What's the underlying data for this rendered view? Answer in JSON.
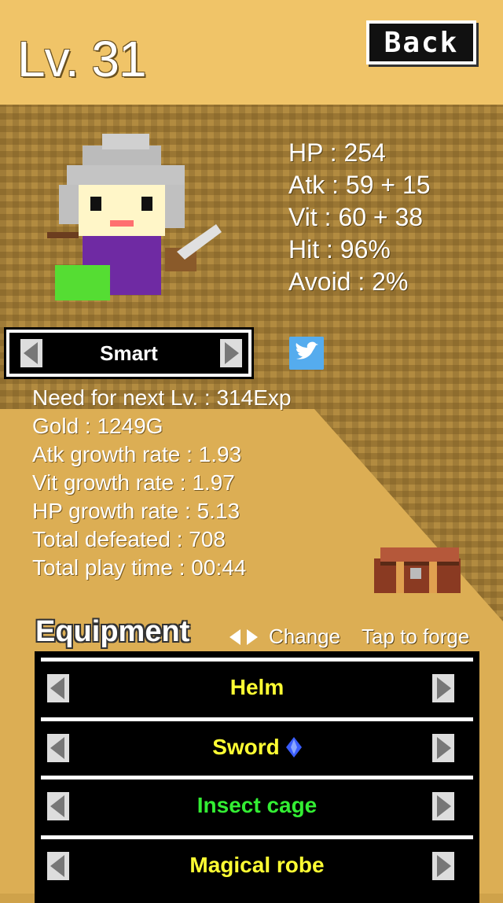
{
  "header": {
    "level": "Lv. 31",
    "back_label": "Back"
  },
  "stats": {
    "hp": "HP : 254",
    "atk": "Atk : 59 + 15",
    "vit": "Vit : 60 + 38",
    "hit": "Hit : 96%",
    "avoid": "Avoid : 2%"
  },
  "character_type": {
    "label": "Smart"
  },
  "info": {
    "next_level": "Need for next Lv. : 314Exp",
    "gold": "Gold : 1249G",
    "atk_growth": "Atk growth rate : 1.93",
    "vit_growth": "Vit growth rate : 1.97",
    "hp_growth": "HP growth rate : 5.13",
    "total_defeated": "Total defeated : 708",
    "play_time": "Total play time : 00:44"
  },
  "equipment": {
    "title": "Equipment",
    "change_hint": "Change",
    "forge_hint": "Tap to forge",
    "slots": [
      {
        "name": "Helm",
        "color": "#ffff33"
      },
      {
        "name": "Sword",
        "color": "#ffff33",
        "gem": "blue-gem-icon"
      },
      {
        "name": "Insect cage",
        "color": "#33ee33"
      },
      {
        "name": "Magical robe",
        "color": "#ffff33"
      }
    ]
  },
  "colors": {
    "header_bg": "#f0c468",
    "sand": "#dcae54",
    "dirt": "#9e7a35",
    "twitter": "#55acee"
  }
}
